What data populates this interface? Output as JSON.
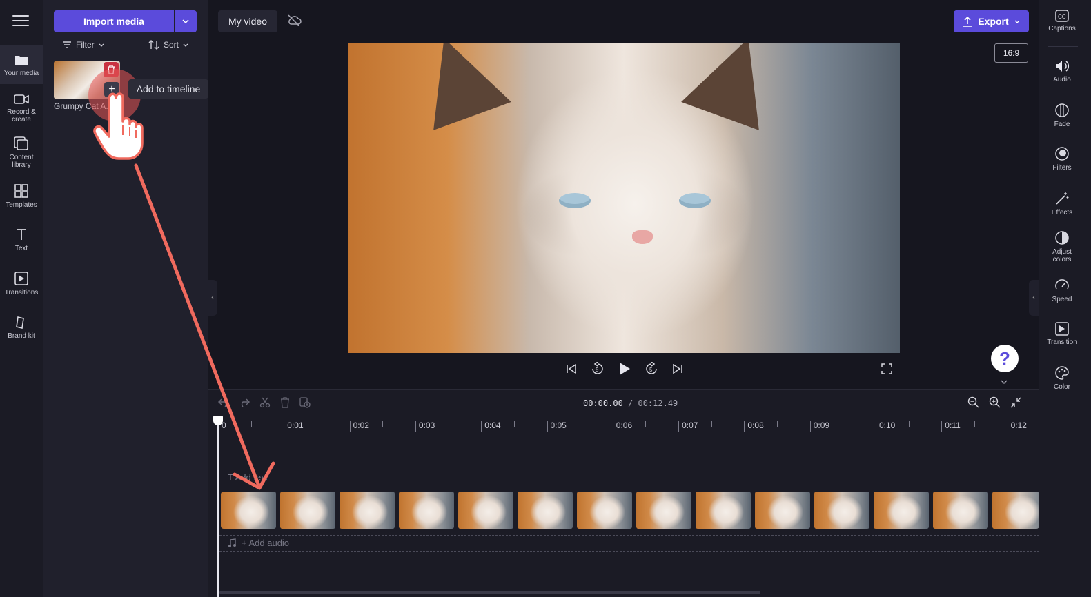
{
  "media_panel": {
    "import_label": "Import media",
    "filter_label": "Filter",
    "sort_label": "Sort",
    "media_items": [
      {
        "label": "Grumpy Cat A..."
      }
    ],
    "tooltip": "Add to timeline"
  },
  "left_rail": [
    {
      "label": "Your media",
      "icon": "folder-icon",
      "active": true
    },
    {
      "label": "Record & create",
      "icon": "camera-icon"
    },
    {
      "label": "Content library",
      "icon": "library-icon"
    },
    {
      "label": "Templates",
      "icon": "templates-icon"
    },
    {
      "label": "Text",
      "icon": "text-icon"
    },
    {
      "label": "Transitions",
      "icon": "transitions-icon"
    },
    {
      "label": "Brand kit",
      "icon": "brand-kit-icon"
    }
  ],
  "header": {
    "title": "My video",
    "export_label": "Export",
    "aspect_ratio": "16:9"
  },
  "right_rail": [
    {
      "label": "Captions",
      "icon": "captions-icon"
    },
    {
      "label": "Audio",
      "icon": "audio-icon"
    },
    {
      "label": "Fade",
      "icon": "fade-icon"
    },
    {
      "label": "Filters",
      "icon": "filters-icon"
    },
    {
      "label": "Effects",
      "icon": "effects-icon"
    },
    {
      "label": "Adjust colors",
      "icon": "adjust-colors-icon"
    },
    {
      "label": "Speed",
      "icon": "speed-icon"
    },
    {
      "label": "Transition",
      "icon": "transition-icon"
    },
    {
      "label": "Color",
      "icon": "color-icon"
    }
  ],
  "player": {
    "help_label": "?"
  },
  "timeline": {
    "current_time": "00:00.00",
    "total_time": "/ 00:12.49",
    "ruler_labels": [
      "0",
      "0:01",
      "0:02",
      "0:03",
      "0:04",
      "0:05",
      "0:06",
      "0:07",
      "0:08",
      "0:09",
      "0:10",
      "0:11",
      "0:12"
    ],
    "text_track_placeholder": "T   Add text",
    "audio_track_placeholder": "+ Add audio",
    "frame_count": 14
  },
  "colors": {
    "accent": "#5b4bdb",
    "annotation": "#f06a5e",
    "delete": "#c93342"
  }
}
